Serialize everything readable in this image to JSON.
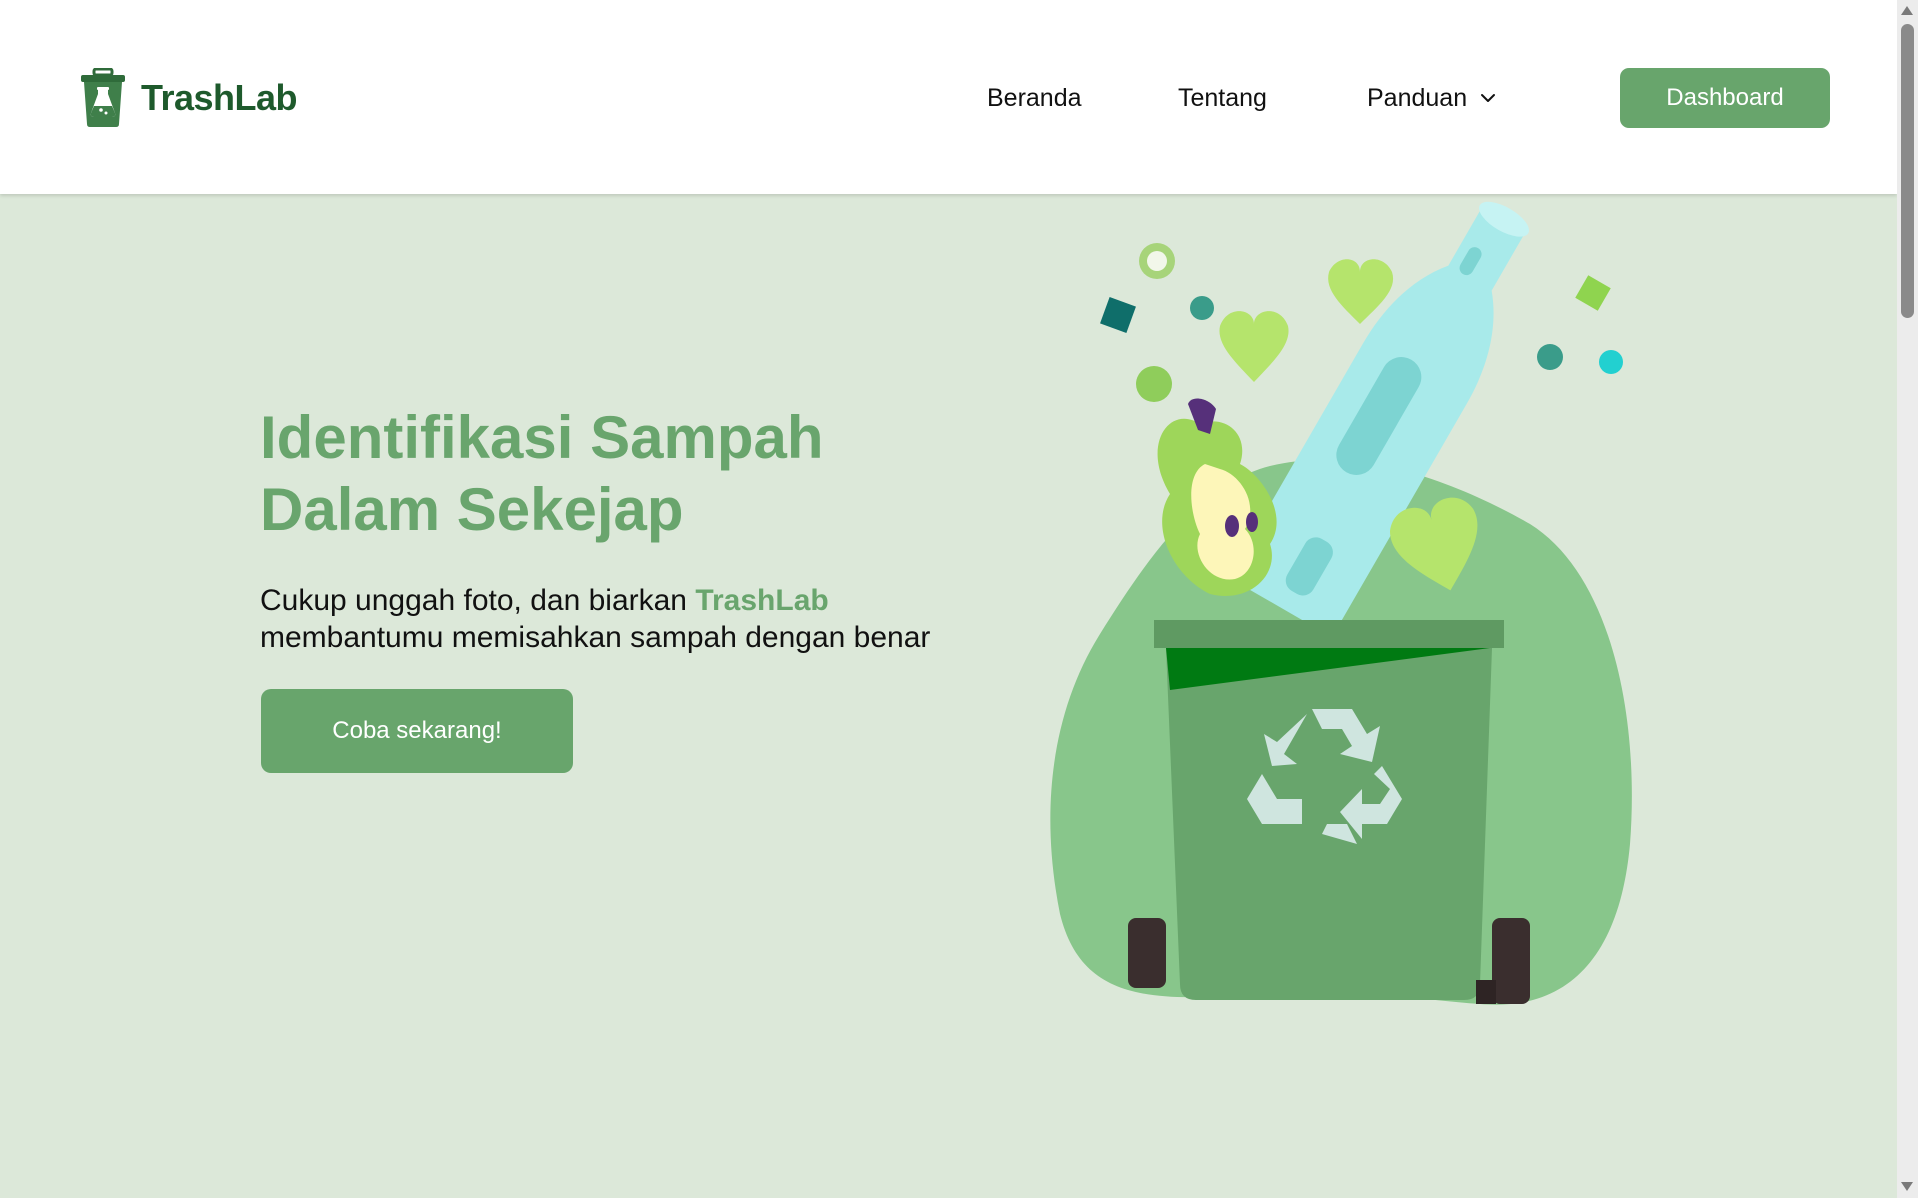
{
  "brand": {
    "name": "TrashLab",
    "logo_icon": "trash-bin-flask-icon",
    "color": "#1e5a2c"
  },
  "nav": {
    "items": [
      {
        "label": "Beranda"
      },
      {
        "label": "Tentang"
      },
      {
        "label": "Panduan",
        "icon": "chevron-down-icon"
      }
    ],
    "dashboard_label": "Dashboard"
  },
  "hero": {
    "title_line1": "Identifikasi Sampah",
    "title_line2": "Dalam Sekejap",
    "subtitle_pre": "Cukup unggah foto, dan biarkan ",
    "subtitle_brand": "TrashLab",
    "subtitle_post": "membantumu memisahkan sampah dengan benar",
    "cta_label": "Coba sekarang!"
  },
  "illustration": {
    "icon": "recycle-bin-with-trash-illustration"
  },
  "colors": {
    "accent": "#68a56c",
    "background": "#dce8d9",
    "header_bg": "#ffffff"
  }
}
